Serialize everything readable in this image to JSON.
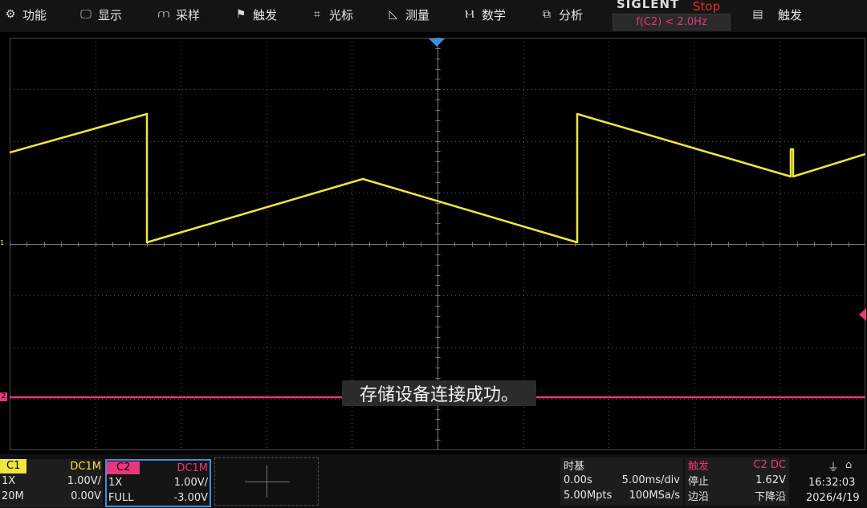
{
  "menu": [
    {
      "label": "功能",
      "icon": "gear-icon"
    },
    {
      "label": "显示",
      "icon": "display-icon"
    },
    {
      "label": "采样",
      "icon": "sampling-icon"
    },
    {
      "label": "触发",
      "icon": "trigger-flag-icon"
    },
    {
      "label": "光标",
      "icon": "cursor-icon"
    },
    {
      "label": "测量",
      "icon": "measure-icon"
    },
    {
      "label": "数学",
      "icon": "math-icon"
    },
    {
      "label": "分析",
      "icon": "analysis-icon"
    },
    {
      "label": "触发",
      "icon": "clipboard-icon"
    }
  ],
  "brand": {
    "name": "SIGLENT",
    "run_state": "Stop",
    "trigger_condition": "f(C2) < 2.0Hz"
  },
  "grid": {
    "h_divisions": 10,
    "v_divisions": 8,
    "color": "#5a5a5a"
  },
  "markers": {
    "ch1": "1",
    "ch2": "2"
  },
  "waveforms": {
    "ch1_color": "#f1e63f",
    "ch2_color": "#e8377b"
  },
  "toast": "存储设备连接成功。",
  "channels": [
    {
      "name": "C1",
      "coupling": "DC1M",
      "probe": "1X",
      "scale": "1.00V/",
      "bandwidth": "20M",
      "offset": "0.00V",
      "color": "#f1e63f"
    },
    {
      "name": "C2",
      "coupling": "DC1M",
      "probe": "1X",
      "scale": "1.00V/",
      "bandwidth": "FULL",
      "offset": "-3.00V",
      "color": "#e8377b"
    }
  ],
  "timebase": {
    "title": "时基",
    "delay": "0.00s",
    "scale": "5.00ms/div",
    "memory": "5.00Mpts",
    "sample_rate": "100MSa/s"
  },
  "trigger": {
    "title": "触发",
    "source": "C2 DC",
    "mode": "停止",
    "level": "1.62V",
    "type": "边沿",
    "slope": "下降沿"
  },
  "system": {
    "time": "16:32:03",
    "date": "2026/4/19"
  }
}
